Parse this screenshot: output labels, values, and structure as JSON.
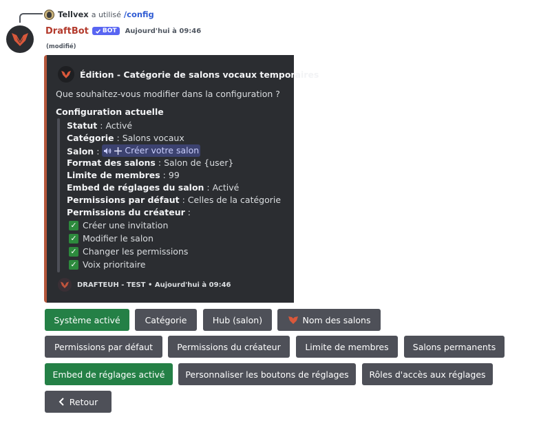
{
  "reply": {
    "username": "Tellvex",
    "verb": "a utilisé",
    "command": "/config"
  },
  "message": {
    "author": "DraftBot",
    "bot_tag": "BOT",
    "timestamp": "Aujourd'hui à 09:46",
    "edited": "(modifié)"
  },
  "embed": {
    "accent_color": "#b4563b",
    "title": "Édition - Catégorie de salons vocaux temporaires",
    "description": "Que souhaitez-vous modifier dans la configuration ?",
    "config_title": "Configuration actuelle",
    "fields": [
      {
        "label": "Statut",
        "value": "Activé"
      },
      {
        "label": "Catégorie",
        "value": "Salons vocaux"
      },
      {
        "label": "Salon",
        "value": "Créer votre salon"
      },
      {
        "label": "Format des salons",
        "value": "Salon de {user}"
      },
      {
        "label": "Limite de membres",
        "value": "99"
      },
      {
        "label": "Embed de réglages du salon",
        "value": "Activé"
      },
      {
        "label": "Permissions par défaut",
        "value": "Celles de la catégorie"
      },
      {
        "label": "Permissions du créateur",
        "value": ""
      }
    ],
    "permissions": [
      "Créer une invitation",
      "Modifier le salon",
      "Changer les permissions",
      "Voix prioritaire"
    ],
    "footer": "DRAFTEUH - TEST • Aujourd'hui à 09:46"
  },
  "buttons": {
    "row1": [
      "Système activé",
      "Catégorie",
      "Hub (salon)",
      "Nom des salons"
    ],
    "row2": [
      "Permissions par défaut",
      "Permissions du créateur",
      "Limite de membres",
      "Salons permanents"
    ],
    "row3": [
      "Embed de réglages activé",
      "Personnaliser les boutons de réglages",
      "Rôles d'accès aux réglages"
    ],
    "back": "Retour"
  },
  "colors": {
    "button_green": "#248046",
    "button_grey": "#4e5058",
    "author": "#b33a2c",
    "bot_tag": "#5865f2"
  }
}
